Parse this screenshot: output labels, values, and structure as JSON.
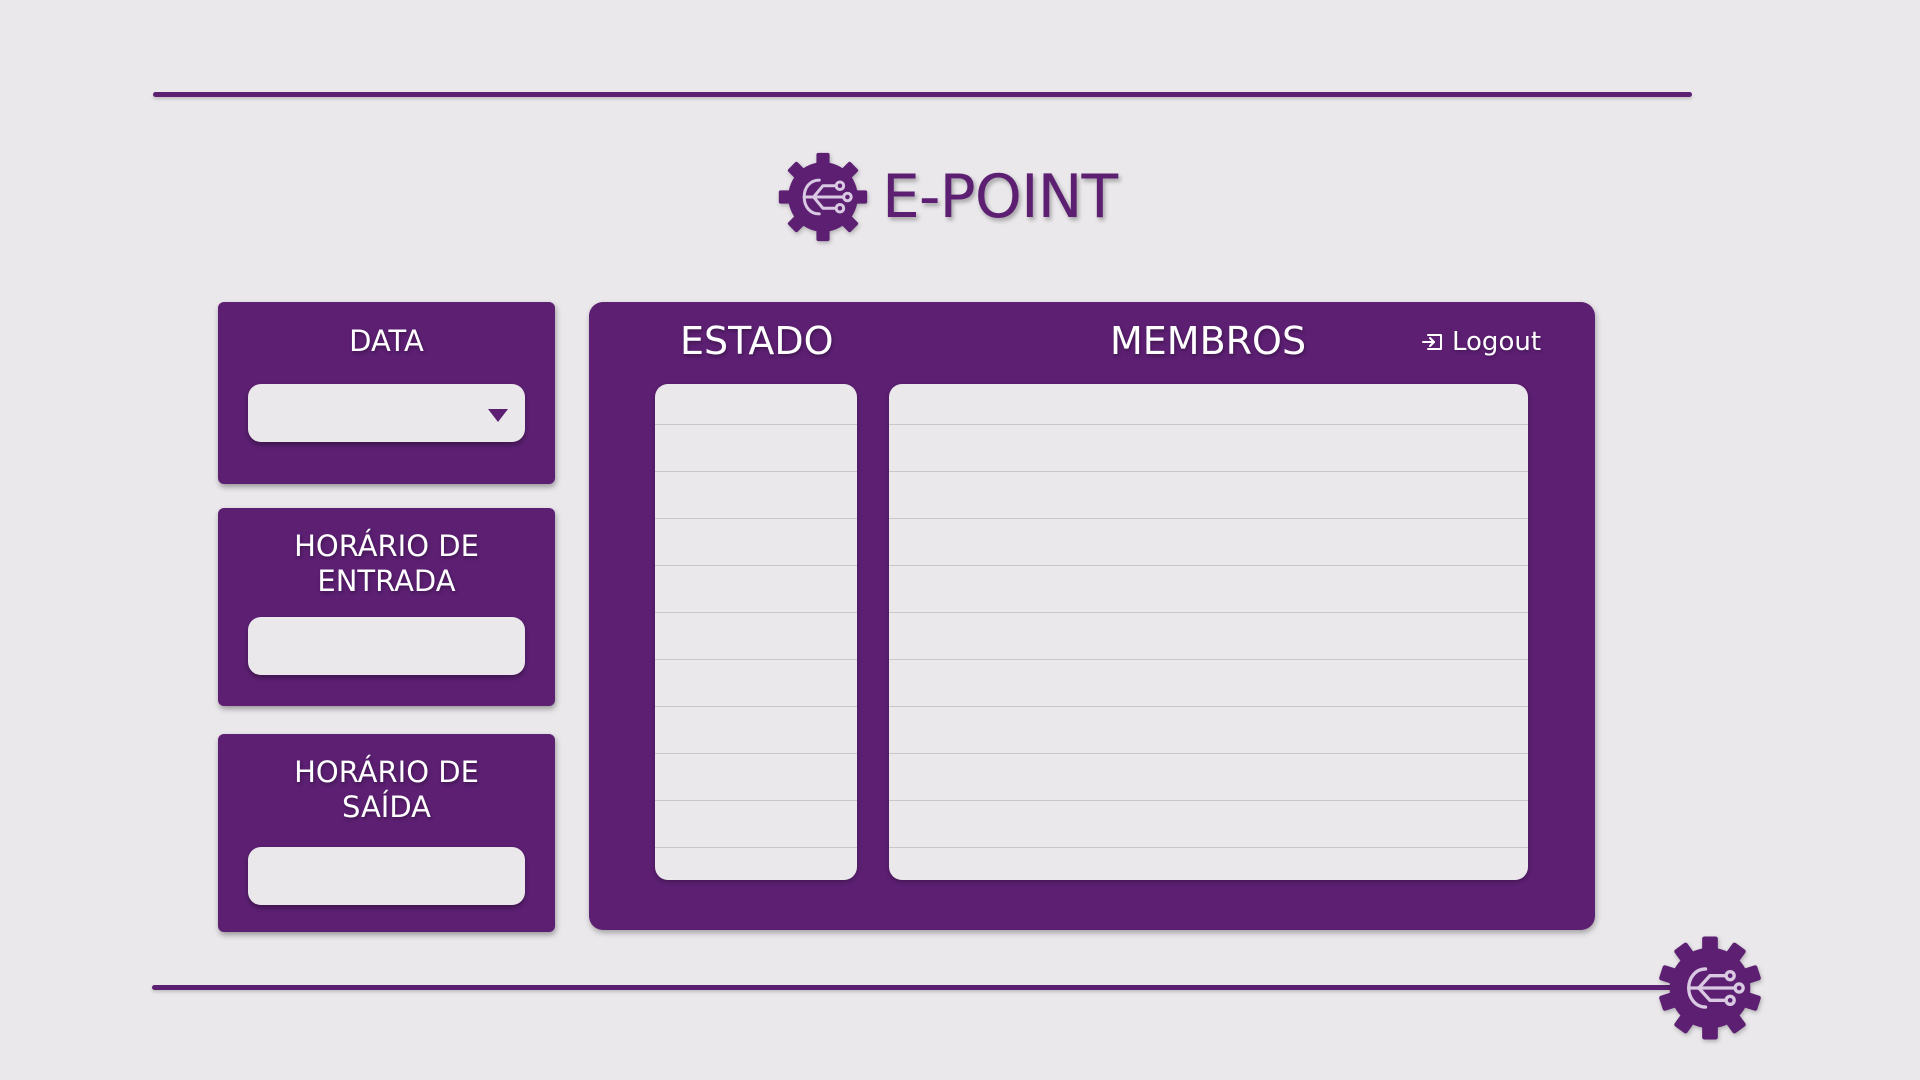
{
  "app": {
    "title": "E-POINT"
  },
  "cards": {
    "data": {
      "label": "DATA",
      "value": ""
    },
    "entrada": {
      "label": "HORÁRIO DE\nENTRADA",
      "value": ""
    },
    "saida": {
      "label": "HORÁRIO DE\nSAÍDA",
      "value": ""
    }
  },
  "main": {
    "estado_header": "ESTADO",
    "membros_header": "MEMBROS",
    "logout_label": "Logout",
    "estado_rows": [
      "",
      "",
      "",
      "",
      "",
      "",
      "",
      "",
      "",
      "",
      ""
    ],
    "membros_rows": [
      "",
      "",
      "",
      "",
      "",
      "",
      "",
      "",
      "",
      "",
      ""
    ]
  },
  "icons": {
    "logo": "gear-circuit-icon",
    "dropdown": "chevron-down-icon",
    "logout": "logout-icon",
    "corner": "gear-circuit-icon"
  },
  "colors": {
    "brand": "#5c1f72",
    "background": "#eae8eb",
    "text_on_brand": "#ffffff"
  }
}
